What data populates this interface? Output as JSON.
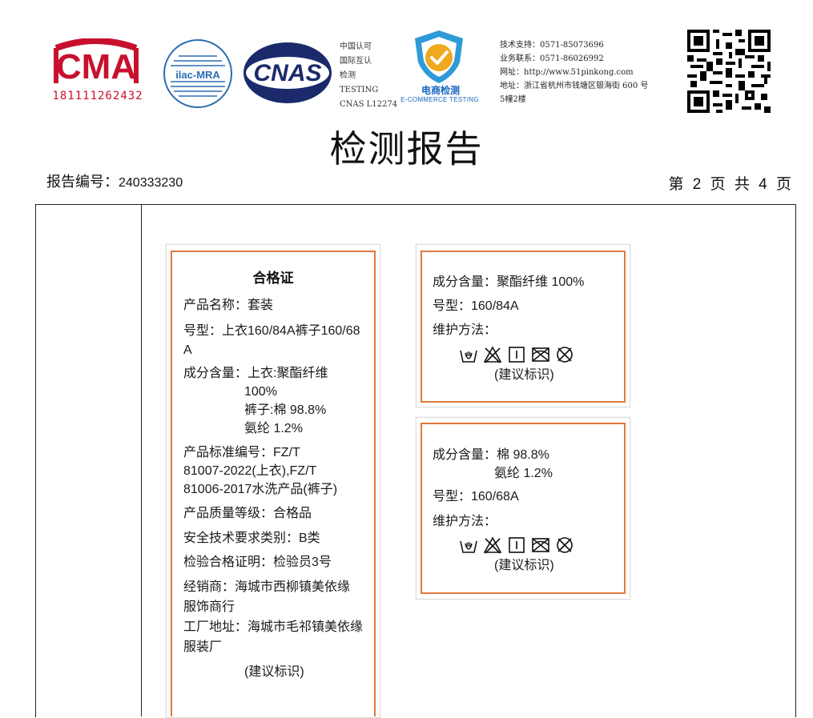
{
  "header": {
    "cma_logo_text": "CMA",
    "cma_number": "181111262432",
    "ilac_logo_text": "ilac-MRA",
    "cnas_logo_text": "CNAS",
    "cert_lines": [
      "中国认可",
      "国际互认",
      "检测",
      "TESTING",
      "CNAS L12274"
    ],
    "ecommerce_title": "电商检测",
    "ecommerce_subtitle": "E-COMMERCE TESTING",
    "contact_lines": [
      "技术支持：0571-85073696",
      "业务联系：0571-86026992",
      "网址：http://www.51pinkong.com",
      "地址：浙江省杭州市钱塘区银海街 600 号",
      "5幢2楼"
    ]
  },
  "document": {
    "title": "检测报告",
    "report_no_label": "报告编号：",
    "report_no": "240333230",
    "page_info": "第 2 页 共 4 页"
  },
  "label_card1": {
    "title": "合格证",
    "lines": [
      "产品名称：套装",
      "号型：上衣160/84A裤子160/68",
      "A",
      "成分含量：上衣:聚酯纤维",
      "100%",
      "裤子:棉 98.8%",
      "氨纶 1.2%",
      "产品标准编号：FZ/T",
      "81007-2022(上衣),FZ/T",
      "81006-2017水洗产品(裤子)",
      "产品质量等级：合格品",
      "安全技术要求类别：B类",
      "检验合格证明：检验员3号",
      "经销商：海城市西柳镇美依缘",
      "服饰商行",
      "工厂地址：海城市毛祁镇美依缘",
      "服装厂",
      "(建议标识)"
    ]
  },
  "label_card2": {
    "composition": "成分含量：聚酯纤维 100%",
    "size": "号型：160/84A",
    "care_label": "维护方法：",
    "advice": "(建议标识)"
  },
  "label_card3": {
    "composition_1": "成分含量：棉 98.8%",
    "composition_2": "氨纶 1.2%",
    "size": "号型：160/68A",
    "care_label": "维护方法：",
    "advice": "(建议标识)"
  },
  "colors": {
    "cma_red": "#c8102e",
    "ilac_blue": "#2c6db3",
    "cnas_navy": "#1b2a6b",
    "ecommerce_blue": "#1565c0",
    "label_border": "#e07a3c"
  },
  "care_icons": [
    "hand-wash-icon",
    "no-bleach-icon",
    "line-dry-icon",
    "no-tumble-dry-icon",
    "no-dry-clean-icon"
  ]
}
